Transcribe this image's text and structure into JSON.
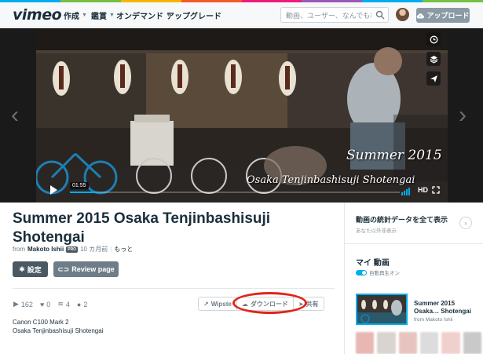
{
  "header": {
    "logo": "vimeo",
    "nav": [
      {
        "label": "作成"
      },
      {
        "label": "鑑賞"
      },
      {
        "label": "オンデマンド"
      },
      {
        "label": "アップグレード"
      }
    ],
    "search_placeholder": "動画、ユーザー、なんでも検索",
    "upload_label": "アップロード",
    "stripe_colors": [
      "#00adef",
      "#76c043",
      "#f7b500",
      "#f15a29",
      "#ec1c7d",
      "#9b59b6",
      "#00adef",
      "#76c043"
    ]
  },
  "video": {
    "time": "01:55",
    "progress": 0.08,
    "overlay_line1": "Summer 2015",
    "overlay_line2": "Osaka Tenjinbashisuji Shotengai",
    "quality": "HD"
  },
  "clip": {
    "title": "Summer 2015 Osaka Tenjinbashisuji Shotengai",
    "from_label": "from",
    "author": "Makoto Ishii",
    "pro_badge": "PRO",
    "age": "10 カ月前",
    "more": "もっと",
    "settings_label": "設定",
    "review_label": "Review page",
    "stats": {
      "plays": "162",
      "likes": "0",
      "collections": "4",
      "comments": "2"
    },
    "actions": {
      "watch_later": "Wipste",
      "download": "ダウンロード",
      "share": "共有"
    },
    "description": [
      "Canon C100 Mark 2",
      "Osaka Tenjinbashisuji Shotengai"
    ]
  },
  "sidebar": {
    "stats_title": "動画の統計データを全て表示",
    "stats_subtitle": "あなた以外非表示",
    "my_videos_title": "マイ 動画",
    "autoplay_label": "自動再生オン",
    "next_video": {
      "title_line1": "Summer 2015",
      "title_line2": "Osaka… Shotengai",
      "byline": "from Makoto Ishii"
    }
  },
  "colors": {
    "accent": "#00adef",
    "annotation_circle": "#e0251b"
  }
}
